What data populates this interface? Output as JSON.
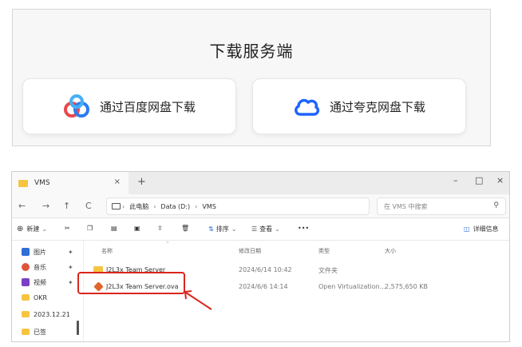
{
  "download_panel": {
    "title": "下载服务端",
    "baidu_label": "通过百度网盘下载",
    "quark_label": "通过夸克网盘下载"
  },
  "window": {
    "tab_title": "VMS",
    "tab_close": "×",
    "tab_add": "+",
    "controls": {
      "minimize": "–",
      "maximize": "□",
      "close": "×"
    }
  },
  "address": {
    "nav": {
      "back": "←",
      "forward": "→",
      "up": "↑",
      "refresh": "C"
    },
    "crumbs": [
      "此电脑",
      "Data (D:)",
      "VMS"
    ],
    "search_placeholder": "在 VMS 中搜索"
  },
  "toolbar": {
    "new_label": "新建",
    "sort_label": "排序",
    "view_label": "查看",
    "more_label": "•••",
    "details_label": "详细信息"
  },
  "sidebar": {
    "items": [
      {
        "label": "图片",
        "color": "#2f6fd6"
      },
      {
        "label": "音乐",
        "color": "#e0553a"
      },
      {
        "label": "视频",
        "color": "#7a3fc4"
      },
      {
        "label": "OKR",
        "color": "#f5c542"
      },
      {
        "label": "2023.12.21",
        "color": "#f5c542"
      },
      {
        "label": "已签",
        "color": "#f5c542"
      }
    ]
  },
  "filelist": {
    "columns": [
      "名称",
      "修改日期",
      "类型",
      "大小"
    ],
    "rows": [
      {
        "name": "J2L3x Team Server",
        "modified": "2024/6/14 10:42",
        "type": "文件夹",
        "size": ""
      },
      {
        "name": "J2L3x Team Server.ova",
        "modified": "2024/6/6 14:14",
        "type": "Open Virtualization...",
        "size": "2,575,650 KB"
      }
    ]
  },
  "colors": {
    "highlight": "#d9261c",
    "folder": "#f5c542",
    "baidu_blue": "#2a7cf0",
    "baidu_red": "#e8484b",
    "quark_blue": "#1f63ff"
  }
}
